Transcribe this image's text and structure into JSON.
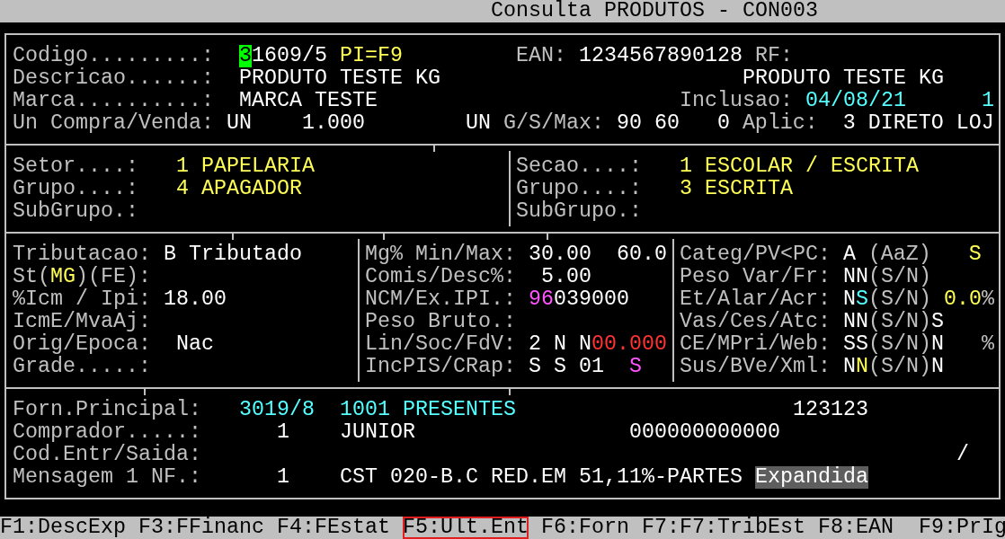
{
  "window": {
    "title": "Consulta PRODUTOS - CON003"
  },
  "panels": [
    {
      "rows": [
        {
          "fields": [
            {
              "label": [
                {
                  "text": "Codigo.........:",
                  "color": "#c0c0c0",
                  "kind": "plain"
                }
              ],
              "values": [
                {
                  "text": "3",
                  "color": "#00ff00",
                  "kind": "cursor"
                },
                {
                  "text": "1609/5",
                  "color": "#ffffff",
                  "kind": "plain"
                },
                {
                  "text": "PI=F9",
                  "color": "#ffff55",
                  "kind": "plain"
                }
              ]
            },
            {
              "label": [
                {
                  "text": "EAN:",
                  "color": "#c0c0c0",
                  "kind": "plain"
                }
              ],
              "values": [
                {
                  "text": "1234567890128",
                  "color": "#ffffff",
                  "kind": "plain"
                }
              ]
            },
            {
              "label": [
                {
                  "text": "RF:",
                  "color": "#c0c0c0",
                  "kind": "plain"
                }
              ]
            }
          ]
        },
        {
          "fields": [
            {
              "label": [
                {
                  "text": "Descricao......:",
                  "color": "#c0c0c0",
                  "kind": "plain"
                }
              ],
              "values": [
                {
                  "text": "PRODUTO TESTE KG",
                  "color": "#ffffff",
                  "kind": "plain"
                },
                {
                  "text": "PRODUTO TESTE KG",
                  "color": "#ffffff",
                  "kind": "plain"
                }
              ]
            }
          ]
        },
        {
          "fields": [
            {
              "label": [
                {
                  "text": "Marca..........:",
                  "color": "#c0c0c0",
                  "kind": "plain"
                }
              ],
              "values": [
                {
                  "text": "MARCA TESTE",
                  "color": "#ffffff",
                  "kind": "plain"
                }
              ]
            },
            {
              "label": [
                {
                  "text": "Inclusao:",
                  "color": "#c0c0c0",
                  "kind": "plain"
                }
              ],
              "values": [
                {
                  "text": "04/08/21",
                  "color": "#55ffff",
                  "kind": "plain"
                },
                {
                  "text": "1",
                  "color": "#55ffff",
                  "kind": "plain"
                }
              ]
            }
          ]
        },
        {
          "fields": [
            {
              "label": [
                {
                  "text": "Un Compra/Venda:",
                  "color": "#c0c0c0",
                  "kind": "plain"
                }
              ],
              "values": [
                {
                  "text": "UN",
                  "color": "#ffffff",
                  "kind": "plain"
                },
                {
                  "text": "1.000",
                  "color": "#ffffff",
                  "kind": "plain"
                },
                {
                  "text": "UN",
                  "color": "#ffffff",
                  "kind": "plain"
                }
              ]
            },
            {
              "label": [
                {
                  "text": "G/S/Max:",
                  "color": "#c0c0c0",
                  "kind": "plain"
                }
              ],
              "values": [
                {
                  "text": "90 60",
                  "color": "#ffffff",
                  "kind": "plain"
                },
                {
                  "text": "0",
                  "color": "#ffffff",
                  "kind": "plain"
                }
              ]
            },
            {
              "label": [
                {
                  "text": "Aplic:",
                  "color": "#c0c0c0",
                  "kind": "plain"
                }
              ],
              "values": [
                {
                  "text": "3 DIRETO LOJ",
                  "color": "#ffffff",
                  "kind": "plain"
                }
              ]
            }
          ]
        }
      ]
    },
    {
      "rows": [
        {
          "fields": [
            {
              "label": [
                {
                  "text": "Setor....:",
                  "color": "#c0c0c0",
                  "kind": "plain"
                }
              ],
              "values": [
                {
                  "text": "1 PAPELARIA",
                  "color": "#ffff55",
                  "kind": "plain"
                }
              ]
            },
            {
              "label": [
                {
                  "text": "Secao....:",
                  "color": "#c0c0c0",
                  "kind": "plain"
                }
              ],
              "values": [
                {
                  "text": "1 ESCOLAR / ESCRITA",
                  "color": "#ffff55",
                  "kind": "plain"
                }
              ]
            }
          ]
        },
        {
          "fields": [
            {
              "label": [
                {
                  "text": "Grupo....:",
                  "color": "#c0c0c0",
                  "kind": "plain"
                }
              ],
              "values": [
                {
                  "text": "4 APAGADOR",
                  "color": "#ffff55",
                  "kind": "plain"
                }
              ]
            },
            {
              "label": [
                {
                  "text": "Grupo....:",
                  "color": "#c0c0c0",
                  "kind": "plain"
                }
              ],
              "values": [
                {
                  "text": "3 ESCRITA",
                  "color": "#ffff55",
                  "kind": "plain"
                }
              ]
            }
          ]
        },
        {
          "fields": [
            {
              "label": [
                {
                  "text": "SubGrupo.:",
                  "color": "#c0c0c0",
                  "kind": "plain"
                }
              ]
            },
            {
              "label": [
                {
                  "text": "SubGrupo.:",
                  "color": "#c0c0c0",
                  "kind": "plain"
                }
              ]
            }
          ]
        }
      ]
    },
    {
      "rows": [
        {
          "fields": [
            {
              "label": [
                {
                  "text": "Tributacao:",
                  "color": "#c0c0c0",
                  "kind": "plain"
                }
              ],
              "values": [
                {
                  "text": "B Tributado",
                  "color": "#ffffff",
                  "kind": "plain"
                }
              ]
            },
            {
              "label": [
                {
                  "text": "Mg% Min/Max:",
                  "color": "#c0c0c0",
                  "kind": "plain"
                }
              ],
              "values": [
                {
                  "text": "30.00",
                  "color": "#ffffff",
                  "kind": "plain"
                },
                {
                  "text": "60.0",
                  "color": "#ffffff",
                  "kind": "plain"
                }
              ]
            },
            {
              "label": [
                {
                  "text": "Categ/PV<PC:",
                  "color": "#c0c0c0",
                  "kind": "plain"
                }
              ],
              "values": [
                {
                  "text": "A",
                  "color": "#ffffff",
                  "kind": "plain"
                },
                {
                  "text": "(AaZ)",
                  "color": "#c0c0c0",
                  "kind": "plain"
                },
                {
                  "text": "S",
                  "color": "#ffff55",
                  "kind": "plain"
                }
              ]
            }
          ]
        },
        {
          "fields": [
            {
              "label": [
                {
                  "text": "St(",
                  "color": "#c0c0c0",
                  "kind": "plain"
                },
                {
                  "text": "MG",
                  "color": "#ffff55",
                  "kind": "plain"
                },
                {
                  "text": ")(FE):",
                  "color": "#c0c0c0",
                  "kind": "plain"
                }
              ]
            },
            {
              "label": [
                {
                  "text": "Comis/Desc%:",
                  "color": "#c0c0c0",
                  "kind": "plain"
                }
              ],
              "values": [
                {
                  "text": "5.00",
                  "color": "#ffffff",
                  "kind": "plain"
                }
              ]
            },
            {
              "label": [
                {
                  "text": "Peso Var/Fr:",
                  "color": "#c0c0c0",
                  "kind": "plain"
                }
              ],
              "values": [
                {
                  "text": "NN",
                  "color": "#ffffff",
                  "kind": "plain"
                },
                {
                  "text": "(S/N)",
                  "color": "#c0c0c0",
                  "kind": "plain"
                }
              ]
            }
          ]
        },
        {
          "fields": [
            {
              "label": [
                {
                  "text": "%Icm / Ipi:",
                  "color": "#c0c0c0",
                  "kind": "plain"
                }
              ],
              "values": [
                {
                  "text": "18.00",
                  "color": "#ffffff",
                  "kind": "plain"
                }
              ]
            },
            {
              "label": [
                {
                  "text": "NCM/Ex.IPI.:",
                  "color": "#c0c0c0",
                  "kind": "plain"
                }
              ],
              "values": [
                {
                  "text": "96",
                  "color": "#ff55ff",
                  "kind": "plain"
                },
                {
                  "text": "039000",
                  "color": "#ffffff",
                  "kind": "plain"
                }
              ]
            },
            {
              "label": [
                {
                  "text": "Et/Alar/Acr:",
                  "color": "#c0c0c0",
                  "kind": "plain"
                }
              ],
              "values": [
                {
                  "text": "N",
                  "color": "#ffffff",
                  "kind": "plain"
                },
                {
                  "text": "S",
                  "color": "#55ffff",
                  "kind": "plain"
                },
                {
                  "text": "(S/N)",
                  "color": "#c0c0c0",
                  "kind": "plain"
                },
                {
                  "text": "0.0",
                  "color": "#ffff55",
                  "kind": "plain"
                },
                {
                  "text": "%",
                  "color": "#c0c0c0",
                  "kind": "plain"
                }
              ]
            }
          ]
        },
        {
          "fields": [
            {
              "label": [
                {
                  "text": "IcmE/MvaAj:",
                  "color": "#c0c0c0",
                  "kind": "plain"
                }
              ]
            },
            {
              "label": [
                {
                  "text": "Peso Bruto.:",
                  "color": "#c0c0c0",
                  "kind": "plain"
                }
              ]
            },
            {
              "label": [
                {
                  "text": "Vas/Ces/Atc:",
                  "color": "#c0c0c0",
                  "kind": "plain"
                }
              ],
              "values": [
                {
                  "text": "NN",
                  "color": "#ffffff",
                  "kind": "plain"
                },
                {
                  "text": "(S/N)",
                  "color": "#c0c0c0",
                  "kind": "plain"
                },
                {
                  "text": "S",
                  "color": "#ffffff",
                  "kind": "plain"
                }
              ]
            }
          ]
        },
        {
          "fields": [
            {
              "label": [
                {
                  "text": "Orig/Epoca:",
                  "color": "#c0c0c0",
                  "kind": "plain"
                }
              ],
              "values": [
                {
                  "text": "Nac",
                  "color": "#ffffff",
                  "kind": "plain"
                }
              ]
            },
            {
              "label": [
                {
                  "text": "Lin/Soc/FdV:",
                  "color": "#c0c0c0",
                  "kind": "plain"
                }
              ],
              "values": [
                {
                  "text": "2 N N",
                  "color": "#ffffff",
                  "kind": "plain"
                },
                {
                  "text": "00.000",
                  "color": "#ff3333",
                  "kind": "plain"
                }
              ]
            },
            {
              "label": [
                {
                  "text": "CE/MPri/Web:",
                  "color": "#c0c0c0",
                  "kind": "plain"
                }
              ],
              "values": [
                {
                  "text": "SS",
                  "color": "#ffffff",
                  "kind": "plain"
                },
                {
                  "text": "(S/N)",
                  "color": "#c0c0c0",
                  "kind": "plain"
                },
                {
                  "text": "N",
                  "color": "#ffffff",
                  "kind": "plain"
                },
                {
                  "text": "%",
                  "color": "#c0c0c0",
                  "kind": "plain"
                }
              ]
            }
          ]
        },
        {
          "fields": [
            {
              "label": [
                {
                  "text": "Grade.....:",
                  "color": "#c0c0c0",
                  "kind": "plain"
                }
              ]
            },
            {
              "label": [
                {
                  "text": "IncPIS/CRap:",
                  "color": "#c0c0c0",
                  "kind": "plain"
                }
              ],
              "values": [
                {
                  "text": "S S 01",
                  "color": "#ffffff",
                  "kind": "plain"
                },
                {
                  "text": "S",
                  "color": "#ff55ff",
                  "kind": "plain"
                }
              ]
            },
            {
              "label": [
                {
                  "text": "Sus/BVe/Xml:",
                  "color": "#c0c0c0",
                  "kind": "plain"
                }
              ],
              "values": [
                {
                  "text": "N",
                  "color": "#ffffff",
                  "kind": "plain"
                },
                {
                  "text": "N",
                  "color": "#ffff55",
                  "kind": "plain"
                },
                {
                  "text": "(S/N)",
                  "color": "#c0c0c0",
                  "kind": "plain"
                },
                {
                  "text": "N",
                  "color": "#ffffff",
                  "kind": "plain"
                }
              ]
            }
          ]
        }
      ]
    },
    {
      "rows": [
        {
          "fields": [
            {
              "label": [
                {
                  "text": "Forn.Principal:",
                  "color": "#c0c0c0",
                  "kind": "plain"
                }
              ],
              "values": [
                {
                  "text": "3019/8",
                  "color": "#55ffff",
                  "kind": "plain"
                },
                {
                  "text": "1001 PRESENTES",
                  "color": "#55ffff",
                  "kind": "plain"
                },
                {
                  "text": "123123",
                  "color": "#ffffff",
                  "kind": "plain"
                }
              ]
            }
          ]
        },
        {
          "fields": [
            {
              "label": [
                {
                  "text": "Comprador.....:",
                  "color": "#c0c0c0",
                  "kind": "plain"
                }
              ],
              "values": [
                {
                  "text": "1",
                  "color": "#ffffff",
                  "kind": "plain"
                },
                {
                  "text": "JUNIOR",
                  "color": "#ffffff",
                  "kind": "plain"
                },
                {
                  "text": "000000000000",
                  "color": "#ffffff",
                  "kind": "plain"
                }
              ]
            }
          ]
        },
        {
          "fields": [
            {
              "label": [
                {
                  "text": "Cod.Entr/Saida:",
                  "color": "#c0c0c0",
                  "kind": "plain"
                }
              ],
              "values": [
                {
                  "text": "/",
                  "color": "#ffffff",
                  "kind": "plain"
                }
              ]
            }
          ]
        },
        {
          "fields": [
            {
              "label": [
                {
                  "text": "Mensagem 1 NF.:",
                  "color": "#c0c0c0",
                  "kind": "plain"
                }
              ],
              "values": [
                {
                  "text": "1",
                  "color": "#ffffff",
                  "kind": "plain"
                },
                {
                  "text": "CST 020-B.C RED.EM 51,11%-PARTES",
                  "color": "#ffffff",
                  "kind": "plain"
                },
                {
                  "text": "Expandida",
                  "color": "#5e5e5e",
                  "kind": "reverse"
                }
              ]
            }
          ]
        }
      ]
    }
  ],
  "function_keys": [
    {
      "label": "F1:DescExp",
      "selected": false
    },
    {
      "label": "F3:FFinanc",
      "selected": false
    },
    {
      "label": "F4:FEstat",
      "selected": false
    },
    {
      "label": "F5:Ult.Ent",
      "selected": true
    },
    {
      "label": "F6:Forn",
      "selected": false
    },
    {
      "label": "F7:F7:TribEst",
      "selected": false
    },
    {
      "label": "F8:EAN",
      "selected": false
    },
    {
      "label": "F9:PrIg",
      "selected": false
    }
  ]
}
